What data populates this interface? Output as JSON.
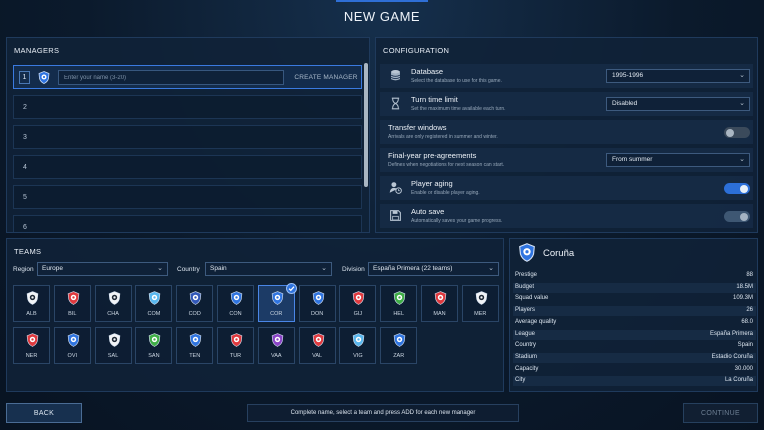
{
  "screen": {
    "title": "NEW GAME"
  },
  "managers": {
    "title": "MANAGERS",
    "name_placeholder": "Enter your name (3-20)",
    "create_label": "CREATE MANAGER",
    "rows": [
      "1",
      "2",
      "3",
      "4",
      "5",
      "6"
    ]
  },
  "config": {
    "title": "CONFIGURATION",
    "database": {
      "label": "Database",
      "desc": "Select the database to use for this game.",
      "value": "1995-1996",
      "icon": "database-icon"
    },
    "turn_time": {
      "label": "Turn time limit",
      "desc": "Set the maximum time available each turn.",
      "value": "Disabled",
      "icon": "hourglass-icon"
    },
    "transfer": {
      "label": "Transfer windows",
      "desc": "Arrivals are only registered in summer and winter.",
      "enabled": false
    },
    "preagreements": {
      "label": "Final-year pre-agreements",
      "desc": "Defines when negotiations for next season can start.",
      "value": "From summer"
    },
    "aging": {
      "label": "Player aging",
      "desc": "Enable or disable player aging.",
      "enabled": true,
      "icon": "user-clock-icon"
    },
    "autosave": {
      "label": "Auto save",
      "desc": "Automatically saves your game progress.",
      "enabled": true,
      "icon": "floppy-icon"
    }
  },
  "teams": {
    "title": "TEAMS",
    "region_label": "Region",
    "region_value": "Europe",
    "country_label": "Country",
    "country_value": "Spain",
    "division_label": "Division",
    "division_value": "España Primera (22 teams)",
    "list": [
      {
        "abbr": "ALB",
        "color": "#f2f4f7"
      },
      {
        "abbr": "BIL",
        "color": "#e0393e"
      },
      {
        "abbr": "CHA",
        "color": "#f2f4f7"
      },
      {
        "abbr": "COM",
        "color": "#58b7ee"
      },
      {
        "abbr": "COD",
        "color": "#3157b8"
      },
      {
        "abbr": "CON",
        "color": "#2f74e0"
      },
      {
        "abbr": "COR",
        "color": "#2f74e0"
      },
      {
        "abbr": "DON",
        "color": "#2f74e0"
      },
      {
        "abbr": "GIJ",
        "color": "#e0393e"
      },
      {
        "abbr": "HEL",
        "color": "#3fae46"
      },
      {
        "abbr": "MAN",
        "color": "#e0393e"
      },
      {
        "abbr": "MER",
        "color": "#f2f4f7"
      },
      {
        "abbr": "NER",
        "color": "#e0393e"
      },
      {
        "abbr": "OVI",
        "color": "#2f74e0"
      },
      {
        "abbr": "SAL",
        "color": "#f2f4f7"
      },
      {
        "abbr": "SAN",
        "color": "#3fae46"
      },
      {
        "abbr": "TEN",
        "color": "#2f74e0"
      },
      {
        "abbr": "TUR",
        "color": "#e0393e"
      },
      {
        "abbr": "VAA",
        "color": "#8b44c7"
      },
      {
        "abbr": "VAL",
        "color": "#e0393e"
      },
      {
        "abbr": "VIG",
        "color": "#58b7ee"
      },
      {
        "abbr": "ZAR",
        "color": "#2f74e0"
      }
    ],
    "selected_index": 6
  },
  "detail": {
    "name": "Coruña",
    "crest_color": "#2f74e0",
    "rows": [
      {
        "k": "Prestige",
        "v": "88"
      },
      {
        "k": "Budget",
        "v": "18.5M"
      },
      {
        "k": "Squad value",
        "v": "109.3M"
      },
      {
        "k": "Players",
        "v": "26"
      },
      {
        "k": "Average quality",
        "v": "68.0"
      },
      {
        "k": "League",
        "v": "España Primera"
      },
      {
        "k": "Country",
        "v": "Spain"
      },
      {
        "k": "Stadium",
        "v": "Estadio Coruña"
      },
      {
        "k": "Capacity",
        "v": "30.000"
      },
      {
        "k": "City",
        "v": "La Coruña"
      }
    ]
  },
  "footer": {
    "back_label": "BACK",
    "hint": "Complete name, select a team and press ADD for each new manager",
    "continue_label": "CONTINUE"
  }
}
